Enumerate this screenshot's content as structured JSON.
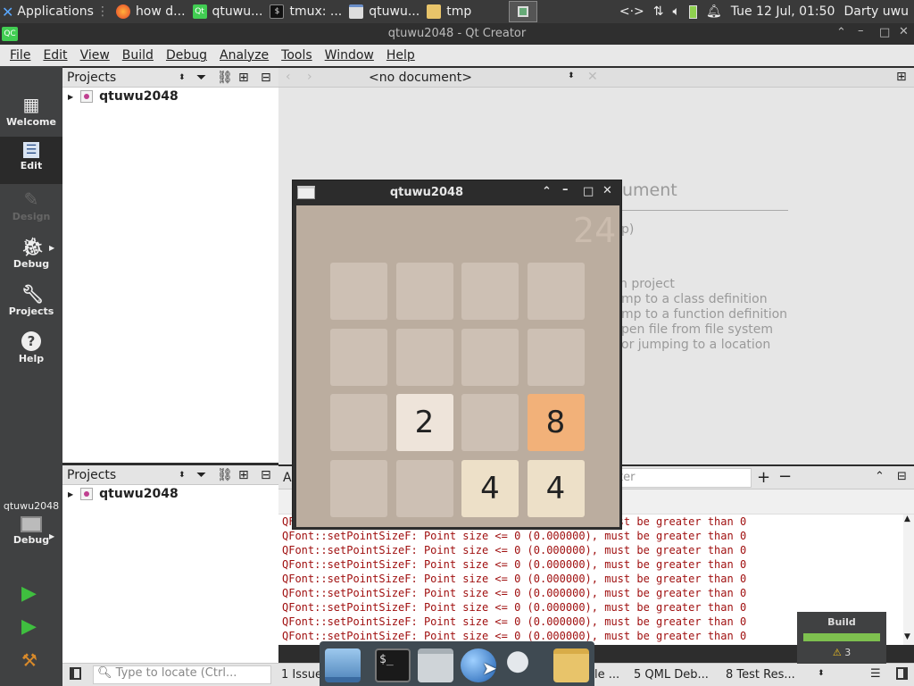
{
  "topbar": {
    "applications": "Applications",
    "tasks": [
      {
        "label": "how d..."
      },
      {
        "label": "qtuwu..."
      },
      {
        "label": "tmux: ..."
      },
      {
        "label": "qtuwu..."
      },
      {
        "label": "tmp"
      }
    ],
    "datetime": "Tue 12 Jul, 01:50",
    "user": "Darty uwu"
  },
  "window": {
    "title": "qtuwu2048 - Qt Creator"
  },
  "menu": [
    "File",
    "Edit",
    "View",
    "Build",
    "Debug",
    "Analyze",
    "Tools",
    "Window",
    "Help"
  ],
  "modes": [
    {
      "label": "Welcome",
      "icon": "grid-icon"
    },
    {
      "label": "Edit",
      "icon": "edit-icon"
    },
    {
      "label": "Design",
      "icon": "pencil-icon"
    },
    {
      "label": "Debug",
      "icon": "bug-icon"
    },
    {
      "label": "Projects",
      "icon": "wrench-icon"
    },
    {
      "label": "Help",
      "icon": "help-icon"
    }
  ],
  "kit": {
    "name": "qtuwu2048",
    "mode": "Debug"
  },
  "projects_panel": {
    "title": "Projects",
    "item": "qtuwu2048"
  },
  "projects_panel2": {
    "title": "Projects",
    "item": "qtuwu2048"
  },
  "editor": {
    "document": "<no document>",
    "bg_heading": "ument",
    "bg_lines": [
      "p)",
      "n project",
      "mp to a class definition",
      "mp to a function definition",
      "pen file from file system",
      "or jumping to a location"
    ]
  },
  "output": {
    "filter_placeholder": "ter",
    "lines": [
      "QFont::setPointSizeF: Point size <= 0 (0.000000), must be greater than 0",
      "QFont::setPointSizeF: Point size <= 0 (0.000000), must be greater than 0",
      "QFont::setPointSizeF: Point size <= 0 (0.000000), must be greater than 0",
      "QFont::setPointSizeF: Point size <= 0 (0.000000), must be greater than 0",
      "QFont::setPointSizeF: Point size <= 0 (0.000000), must be greater than 0",
      "QFont::setPointSizeF: Point size <= 0 (0.000000), must be greater than 0",
      "QFont::setPointSizeF: Point size <= 0 (0.000000), must be greater than 0",
      "QFont::setPointSizeF: Point size <= 0 (0.000000), must be greater than 0",
      "QFont::setPointSizeF: Point size <= 0 (0.000000), must be greater than 0"
    ]
  },
  "statusbar": {
    "locate_placeholder": "Type to locate (Ctrl...",
    "tabs": [
      "1 Issue",
      "le ...",
      "5 QML Deb...",
      "8 Test Res..."
    ]
  },
  "build": {
    "label": "Build",
    "warnings": "3"
  },
  "game": {
    "title": "qtuwu2048",
    "score": "24",
    "grid": [
      [
        "",
        "",
        "",
        ""
      ],
      [
        "",
        "",
        "",
        ""
      ],
      [
        "",
        "2",
        "",
        "8"
      ],
      [
        "",
        "",
        "4",
        "4"
      ]
    ]
  },
  "colors": {
    "tile_empty": "#cdc0b4",
    "tile_2": "#eee4da",
    "tile_4": "#ede0c8",
    "tile_8": "#f2b179",
    "board": "#bbad9f",
    "output_error": "#a01010"
  }
}
